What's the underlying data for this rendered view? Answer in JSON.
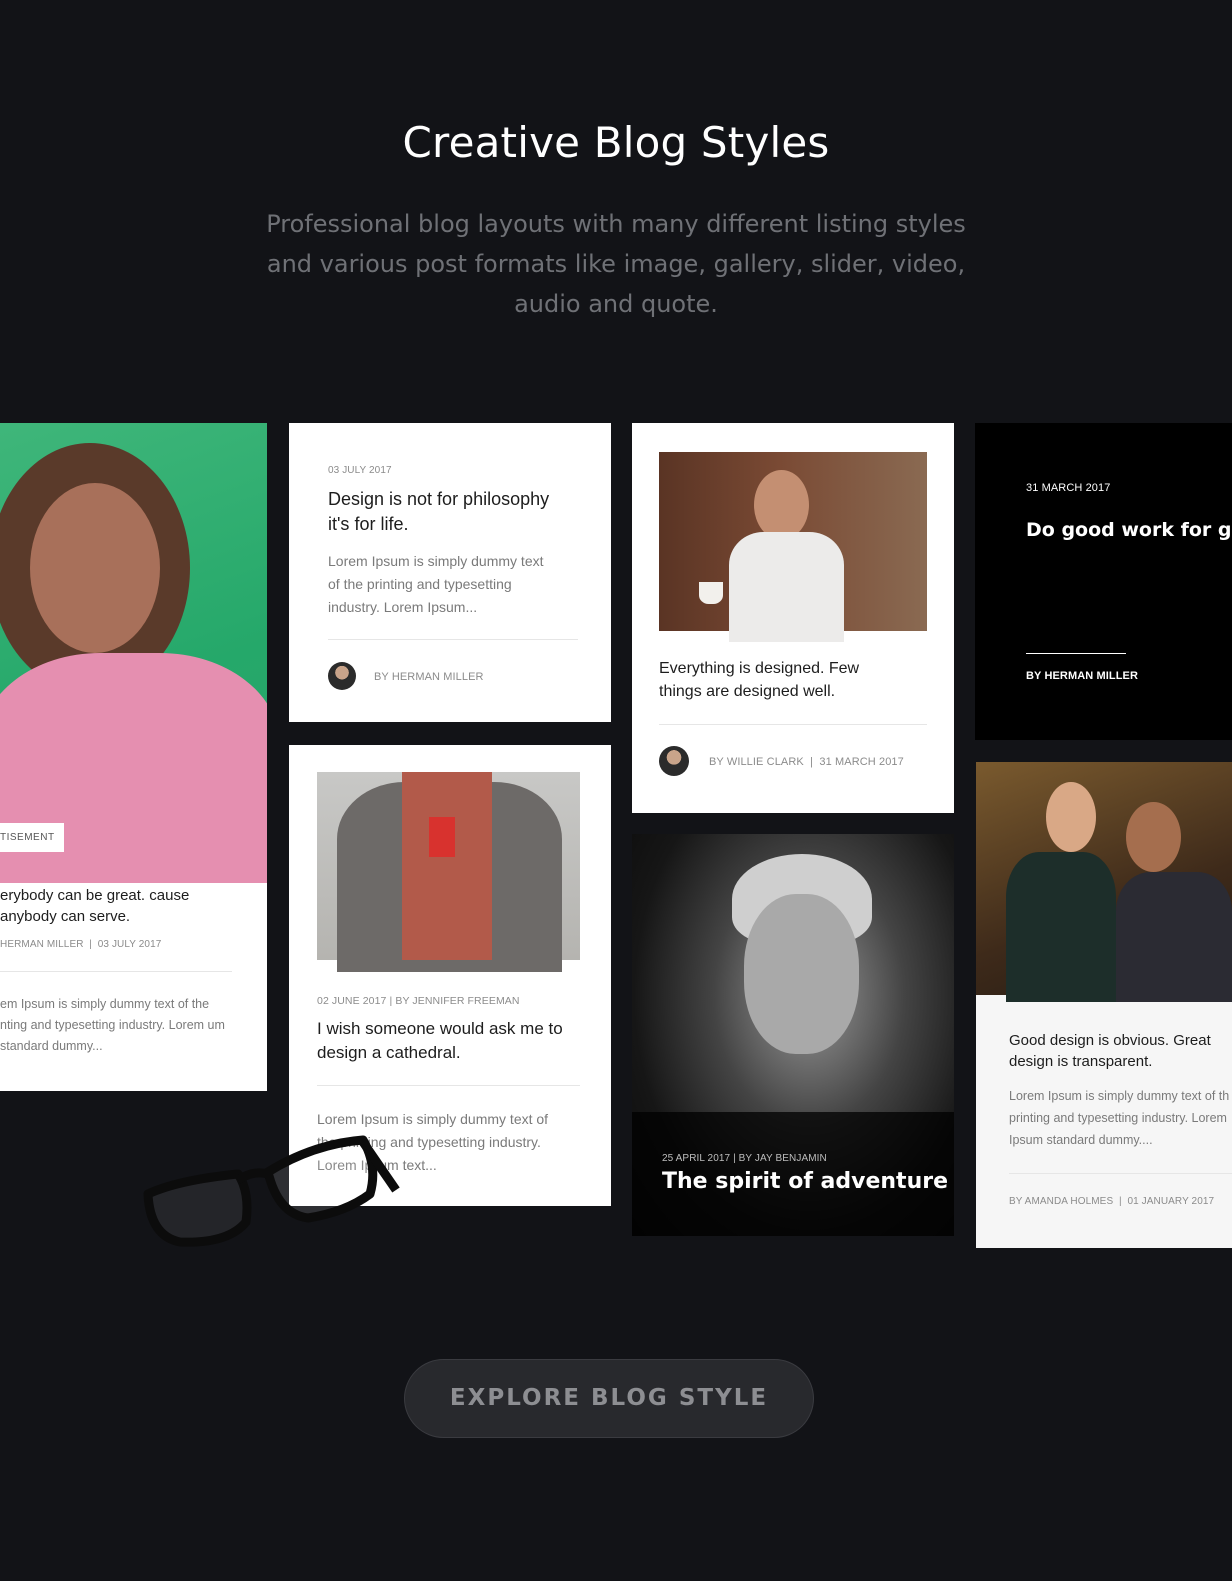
{
  "header": {
    "title": "Creative Blog Styles",
    "subtitle": "Professional blog layouts with many different listing styles and various post formats like image, gallery, slider, video, audio and quote."
  },
  "cards": {
    "c1": {
      "tag": "TISEMENT",
      "title": "erybody can be great. cause anybody can serve.",
      "meta": "HERMAN MILLER  |  03 JULY 2017",
      "excerpt": "em Ipsum is simply dummy text of the nting and typesetting industry. Lorem um standard dummy..."
    },
    "c2": {
      "date": "03 JULY 2017",
      "title": "Design is not for philosophy it's for life.",
      "excerpt": "Lorem Ipsum is simply dummy text of the printing and typesetting industry. Lorem Ipsum...",
      "author": "BY HERMAN MILLER"
    },
    "c3": {
      "meta": "02 JUNE 2017 | BY JENNIFER FREEMAN",
      "title": "I wish someone would ask me to design a cathedral.",
      "excerpt": "Lorem Ipsum is simply dummy text of the printing and typesetting industry. Lorem Ipsum text..."
    },
    "c4": {
      "title": "Everything is designed. Few things are designed well.",
      "meta": "BY WILLIE CLARK  |  31 MARCH 2017"
    },
    "c5": {
      "meta": "25 APRIL 2017 | BY JAY BENJAMIN",
      "title": "The spirit of adventure"
    },
    "c6": {
      "date": "31 MARCH 2017",
      "quote": "Do good work for go people. Good design language, not a style",
      "author": "BY HERMAN MILLER"
    },
    "c7": {
      "title": "Good design is obvious. Great design is transparent.",
      "excerpt": "Lorem Ipsum is simply dummy text of th printing and typesetting industry. Lorem Ipsum standard dummy....",
      "meta": "BY AMANDA HOLMES  |  01 JANUARY 2017"
    }
  },
  "cta": {
    "label": "EXPLORE BLOG STYLE"
  }
}
